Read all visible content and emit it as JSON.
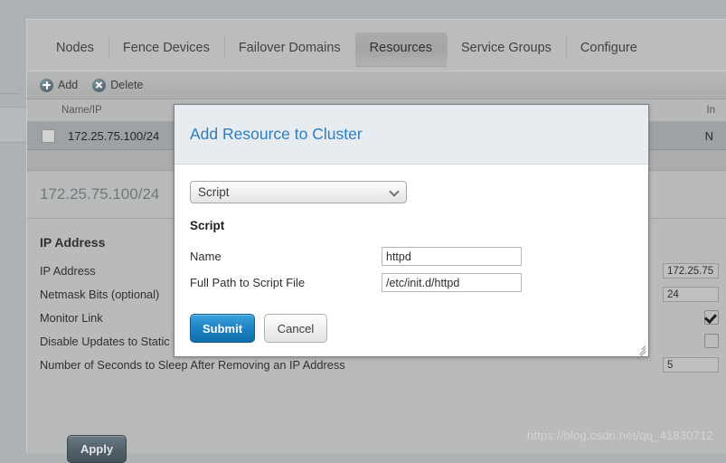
{
  "tabs": [
    {
      "label": "Nodes",
      "active": false
    },
    {
      "label": "Fence Devices",
      "active": false
    },
    {
      "label": "Failover Domains",
      "active": false
    },
    {
      "label": "Resources",
      "active": true
    },
    {
      "label": "Service Groups",
      "active": false
    },
    {
      "label": "Configure",
      "active": false
    }
  ],
  "toolbar": {
    "add_label": "Add",
    "add_icon": "plus-circle-icon",
    "delete_label": "Delete",
    "delete_icon": "x-circle-icon"
  },
  "resource_table": {
    "columns": {
      "name": "Name/IP",
      "ip": "In"
    },
    "rows": [
      {
        "name": "172.25.75.100/24",
        "ip": "N",
        "checked": false
      }
    ]
  },
  "detail": {
    "title": "172.25.75.100/24",
    "section_heading": "IP Address",
    "fields": [
      {
        "label": "IP Address",
        "type": "text",
        "value": "172.25.75"
      },
      {
        "label": "Netmask Bits (optional)",
        "type": "text",
        "value": "24"
      },
      {
        "label": "Monitor Link",
        "type": "checkbox",
        "checked": true
      },
      {
        "label": "Disable Updates to Static R",
        "type": "checkbox",
        "checked": false
      },
      {
        "label": "Number of Seconds to Sleep After Removing an IP Address",
        "type": "text",
        "value": "5"
      }
    ],
    "apply_label": "Apply"
  },
  "modal": {
    "title": "Add Resource to Cluster",
    "resource_type": {
      "selected": "Script",
      "chevron_icon": "chevron-down-icon"
    },
    "section_heading": "Script",
    "fields": [
      {
        "label": "Name",
        "value": "httpd",
        "placeholder": ""
      },
      {
        "label": "Full Path to Script File",
        "value": "/etc/init.d/httpd",
        "placeholder": ""
      }
    ],
    "submit_label": "Submit",
    "cancel_label": "Cancel",
    "resize_grip_icon": "resize-grip-icon"
  },
  "watermark": "https://blog.csdn.net/qq_41830712",
  "colors": {
    "accent_blue": "#2f7dbd",
    "selected_row": "#8ea5b6",
    "panel_gray": "#b7babd",
    "modal_header": "#e7ecf0"
  }
}
